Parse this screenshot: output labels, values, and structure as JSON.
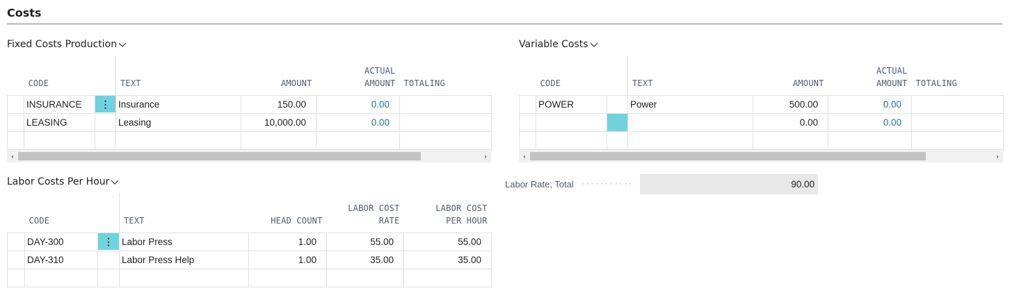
{
  "page": {
    "title": "Costs"
  },
  "fixed_costs": {
    "title": "Fixed Costs Production",
    "columns": {
      "code": "CODE",
      "text": "TEXT",
      "amount": "AMOUNT",
      "actual_amount_1": "ACTUAL",
      "actual_amount_2": "AMOUNT",
      "totaling": "TOTALING"
    },
    "rows": [
      {
        "code": "INSURANCE",
        "text": "Insurance",
        "amount": "150.00",
        "actual_amount": "0.00",
        "totaling": ""
      },
      {
        "code": "LEASING",
        "text": "Leasing",
        "amount": "10,000.00",
        "actual_amount": "0.00",
        "totaling": ""
      }
    ],
    "scroll_left": "‹",
    "scroll_right": "›"
  },
  "variable_costs": {
    "title": "Variable Costs",
    "columns": {
      "code": "CODE",
      "text": "TEXT",
      "amount": "AMOUNT",
      "actual_amount_1": "ACTUAL",
      "actual_amount_2": "AMOUNT",
      "totaling": "TOTALING"
    },
    "rows": [
      {
        "code": "POWER",
        "text": "Power",
        "amount": "500.00",
        "actual_amount": "0.00",
        "totaling": ""
      },
      {
        "code": "",
        "text": "",
        "amount": "0.00",
        "actual_amount": "0.00",
        "totaling": ""
      }
    ],
    "scroll_left": "‹",
    "scroll_right": "›"
  },
  "labor_costs": {
    "title": "Labor Costs Per Hour",
    "columns": {
      "code": "CODE",
      "text": "TEXT",
      "head_count": "HEAD COUNT",
      "rate_1": "LABOR COST",
      "rate_2": "RATE",
      "per_hour_1": "LABOR COST",
      "per_hour_2": "PER HOUR"
    },
    "rows": [
      {
        "code": "DAY-300",
        "text": "Labor Press",
        "head_count": "1.00",
        "rate": "55.00",
        "per_hour": "55.00"
      },
      {
        "code": "DAY-310",
        "text": "Labor Press Help",
        "head_count": "1.00",
        "rate": "35.00",
        "per_hour": "35.00"
      }
    ]
  },
  "labor_rate_total": {
    "label": "Labor Rate, Total",
    "value": "90.00"
  },
  "menu_glyph": "⋮"
}
